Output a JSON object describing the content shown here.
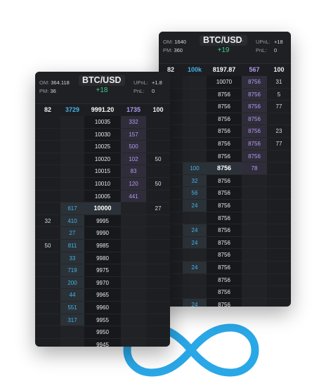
{
  "colors": {
    "accent_cyan": "#45b4e6",
    "ask_purple": "#b39bf0",
    "pnl_green": "#3fc98d",
    "logo_blue": "#2aa7e6"
  },
  "back_panel": {
    "header": {
      "om_label": "OM:",
      "om_value": "1640",
      "pm_label": "PM:",
      "pm_value": "360",
      "symbol": "BTC/USD",
      "pnl": "+19",
      "upnl_label": "UPnL:",
      "upnl_value": "+18",
      "pnl_label": "PnL:",
      "pnl_value": "0"
    },
    "totals": {
      "bid_volume": "82",
      "bids": "100k",
      "price": "8197.87",
      "asks": "567",
      "ask_volume": "100"
    },
    "rows": [
      {
        "bv": "",
        "bid": "",
        "price": "10070",
        "ask": "8756",
        "av": "31"
      },
      {
        "bv": "",
        "bid": "",
        "price": "8756",
        "ask": "8756",
        "av": "5"
      },
      {
        "bv": "",
        "bid": "",
        "price": "8756",
        "ask": "8756",
        "av": "77"
      },
      {
        "bv": "",
        "bid": "",
        "price": "8756",
        "ask": "8756",
        "av": ""
      },
      {
        "bv": "",
        "bid": "",
        "price": "8756",
        "ask": "8756",
        "av": "23"
      },
      {
        "bv": "",
        "bid": "",
        "price": "8756",
        "ask": "8756",
        "av": "77"
      },
      {
        "bv": "",
        "bid": "",
        "price": "8756",
        "ask": "8756",
        "av": ""
      },
      {
        "bv": "",
        "bid": "100",
        "price": "8756",
        "ask": "78",
        "av": "",
        "current": true
      },
      {
        "bv": "",
        "bid": "32",
        "price": "8756",
        "ask": "",
        "av": ""
      },
      {
        "bv": "",
        "bid": "56",
        "price": "8756",
        "ask": "",
        "av": ""
      },
      {
        "bv": "",
        "bid": "24",
        "price": "8756",
        "ask": "",
        "av": ""
      },
      {
        "bv": "",
        "bid": "",
        "price": "8756",
        "ask": "",
        "av": ""
      },
      {
        "bv": "",
        "bid": "24",
        "price": "8756",
        "ask": "",
        "av": ""
      },
      {
        "bv": "",
        "bid": "24",
        "price": "8756",
        "ask": "",
        "av": ""
      },
      {
        "bv": "",
        "bid": "",
        "price": "8756",
        "ask": "",
        "av": ""
      },
      {
        "bv": "",
        "bid": "24",
        "price": "8756",
        "ask": "",
        "av": ""
      },
      {
        "bv": "",
        "bid": "",
        "price": "8756",
        "ask": "",
        "av": ""
      },
      {
        "bv": "",
        "bid": "",
        "price": "8756",
        "ask": "",
        "av": ""
      },
      {
        "bv": "",
        "bid": "24",
        "price": "8756",
        "ask": "",
        "av": ""
      }
    ]
  },
  "front_panel": {
    "header": {
      "om_label": "OM:",
      "om_value": "364.118",
      "pm_label": "PM:",
      "pm_value": "36",
      "symbol": "BTC/USD",
      "pnl": "+18",
      "upnl_label": "UPnL:",
      "upnl_value": "+1.8",
      "pnl_label": "PnL:",
      "pnl_value": "0"
    },
    "totals": {
      "bid_volume": "82",
      "bids": "3729",
      "price": "9991.20",
      "asks": "1735",
      "ask_volume": "100"
    },
    "rows": [
      {
        "bv": "",
        "bid": "",
        "price": "10035",
        "ask": "332",
        "av": ""
      },
      {
        "bv": "",
        "bid": "",
        "price": "10030",
        "ask": "157",
        "av": ""
      },
      {
        "bv": "",
        "bid": "",
        "price": "10025",
        "ask": "500",
        "av": ""
      },
      {
        "bv": "",
        "bid": "",
        "price": "10020",
        "ask": "102",
        "av": "50"
      },
      {
        "bv": "",
        "bid": "",
        "price": "10015",
        "ask": "83",
        "av": ""
      },
      {
        "bv": "",
        "bid": "",
        "price": "10010",
        "ask": "120",
        "av": "50"
      },
      {
        "bv": "",
        "bid": "",
        "price": "10005",
        "ask": "441",
        "av": ""
      },
      {
        "bv": "",
        "bid": "617",
        "price": "10000",
        "ask": "",
        "av": "27",
        "current": true
      },
      {
        "bv": "32",
        "bid": "410",
        "price": "9995",
        "ask": "",
        "av": ""
      },
      {
        "bv": "",
        "bid": "27",
        "price": "9990",
        "ask": "",
        "av": ""
      },
      {
        "bv": "50",
        "bid": "811",
        "price": "9985",
        "ask": "",
        "av": ""
      },
      {
        "bv": "",
        "bid": "33",
        "price": "9980",
        "ask": "",
        "av": ""
      },
      {
        "bv": "",
        "bid": "719",
        "price": "9975",
        "ask": "",
        "av": ""
      },
      {
        "bv": "",
        "bid": "200",
        "price": "9970",
        "ask": "",
        "av": ""
      },
      {
        "bv": "",
        "bid": "44",
        "price": "9965",
        "ask": "",
        "av": ""
      },
      {
        "bv": "",
        "bid": "551",
        "price": "9960",
        "ask": "",
        "av": ""
      },
      {
        "bv": "",
        "bid": "317",
        "price": "9955",
        "ask": "",
        "av": ""
      },
      {
        "bv": "",
        "bid": "",
        "price": "9950",
        "ask": "",
        "av": ""
      },
      {
        "bv": "",
        "bid": "",
        "price": "9945",
        "ask": "",
        "av": ""
      }
    ]
  }
}
